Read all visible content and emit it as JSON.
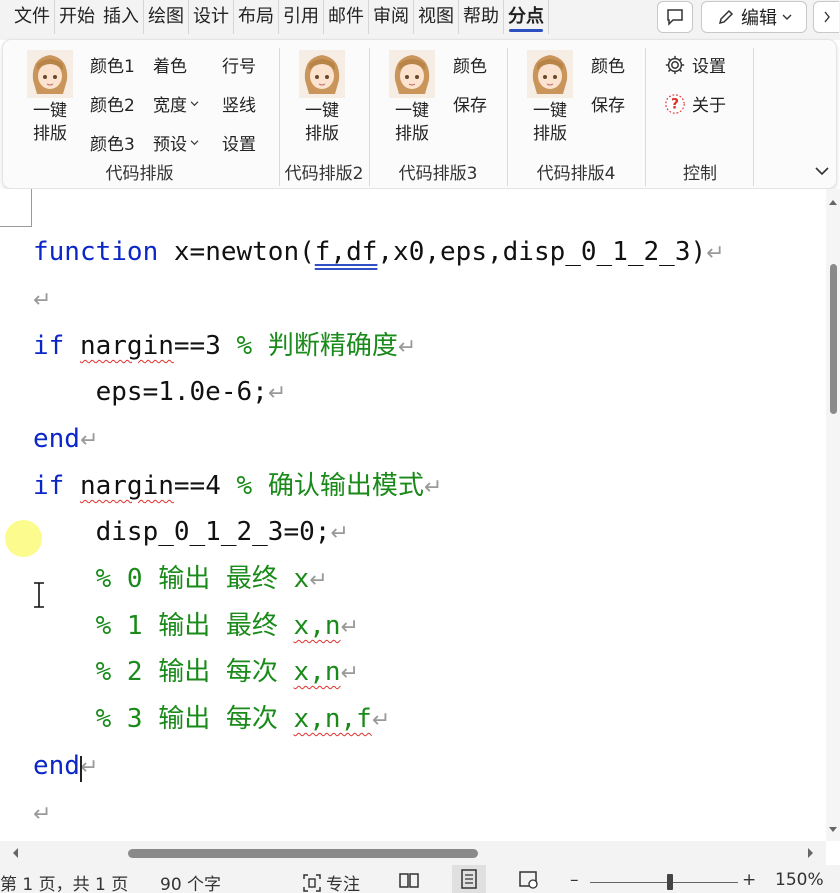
{
  "menu": {
    "tabs": [
      "文件",
      "开始",
      "插入",
      "绘图",
      "设计",
      "布局",
      "引用",
      "邮件",
      "审阅",
      "视图",
      "帮助",
      "分点"
    ],
    "active_tab": "分点",
    "edit_label": "编辑"
  },
  "ribbon": {
    "group1": {
      "label": "代码排版",
      "big_button": "一键\n排版",
      "col1": [
        "颜色1",
        "颜色2",
        "颜色3"
      ],
      "col2": [
        "着色",
        "宽度",
        "预设"
      ],
      "col3": [
        "行号",
        "竖线",
        "设置"
      ]
    },
    "group2": {
      "label": "代码排版2",
      "big_button": "一键\n排版"
    },
    "group3": {
      "label": "代码排版3",
      "big_button": "一键\n排版",
      "items": [
        "颜色",
        "保存"
      ]
    },
    "group4": {
      "label": "代码排版4",
      "big_button": "一键\n排版",
      "items": [
        "颜色",
        "保存"
      ]
    },
    "control": {
      "label": "控制",
      "settings": "设置",
      "about": "关于"
    }
  },
  "document": {
    "lines": [
      {
        "seg": [
          [
            "kw",
            "function"
          ],
          [
            "code",
            " x=newton("
          ],
          [
            "dbl",
            "f,df"
          ],
          [
            "code",
            ",x0,eps,disp_0_1_2_3)"
          ]
        ]
      },
      {
        "seg": []
      },
      {
        "seg": [
          [
            "kw",
            "if"
          ],
          [
            "code",
            " "
          ],
          [
            "wavy",
            "nargin"
          ],
          [
            "code",
            "==3 "
          ],
          [
            "cm",
            "% 判断精确度"
          ]
        ]
      },
      {
        "seg": [
          [
            "code",
            "    eps=1.0e-6;"
          ]
        ]
      },
      {
        "seg": [
          [
            "kw",
            "end"
          ]
        ]
      },
      {
        "seg": [
          [
            "kw",
            "if"
          ],
          [
            "code",
            " "
          ],
          [
            "wavy",
            "nargin"
          ],
          [
            "code",
            "==4 "
          ],
          [
            "cm",
            "% 确认输出模式"
          ]
        ]
      },
      {
        "seg": [
          [
            "code",
            "    disp_0_1_2_3=0;"
          ]
        ]
      },
      {
        "seg": [
          [
            "cm",
            "    % 0 输出 最终 x"
          ]
        ]
      },
      {
        "seg": [
          [
            "cm",
            "    % 1 输出 最终 "
          ],
          [
            "cmwavy",
            "x,n"
          ]
        ]
      },
      {
        "seg": [
          [
            "cm",
            "    % 2 输出 每次 "
          ],
          [
            "cmwavy",
            "x,n"
          ]
        ]
      },
      {
        "seg": [
          [
            "cm",
            "    % 3 输出 每次 "
          ],
          [
            "cmwavy",
            "x,n,f"
          ]
        ]
      },
      {
        "seg": [
          [
            "kw",
            "end"
          ]
        ]
      },
      {
        "seg": []
      }
    ]
  },
  "status": {
    "page": "第 1 页，共 1 页",
    "words": "90 个字",
    "focus": "专注",
    "zoom": "150%"
  },
  "colors": {
    "keyword": "#0b27c8",
    "comment": "#1a8a1a",
    "accent": "#2b4fbf"
  },
  "icons": [
    "comment-icon",
    "pencil-icon",
    "chevron-down-icon",
    "chevron-right-icon",
    "gear-icon",
    "question-icon",
    "avatar-icon",
    "paragraph-mark-icon",
    "ibeam-icon",
    "focus-icon",
    "read-mode-icon",
    "print-layout-icon",
    "web-layout-icon"
  ]
}
